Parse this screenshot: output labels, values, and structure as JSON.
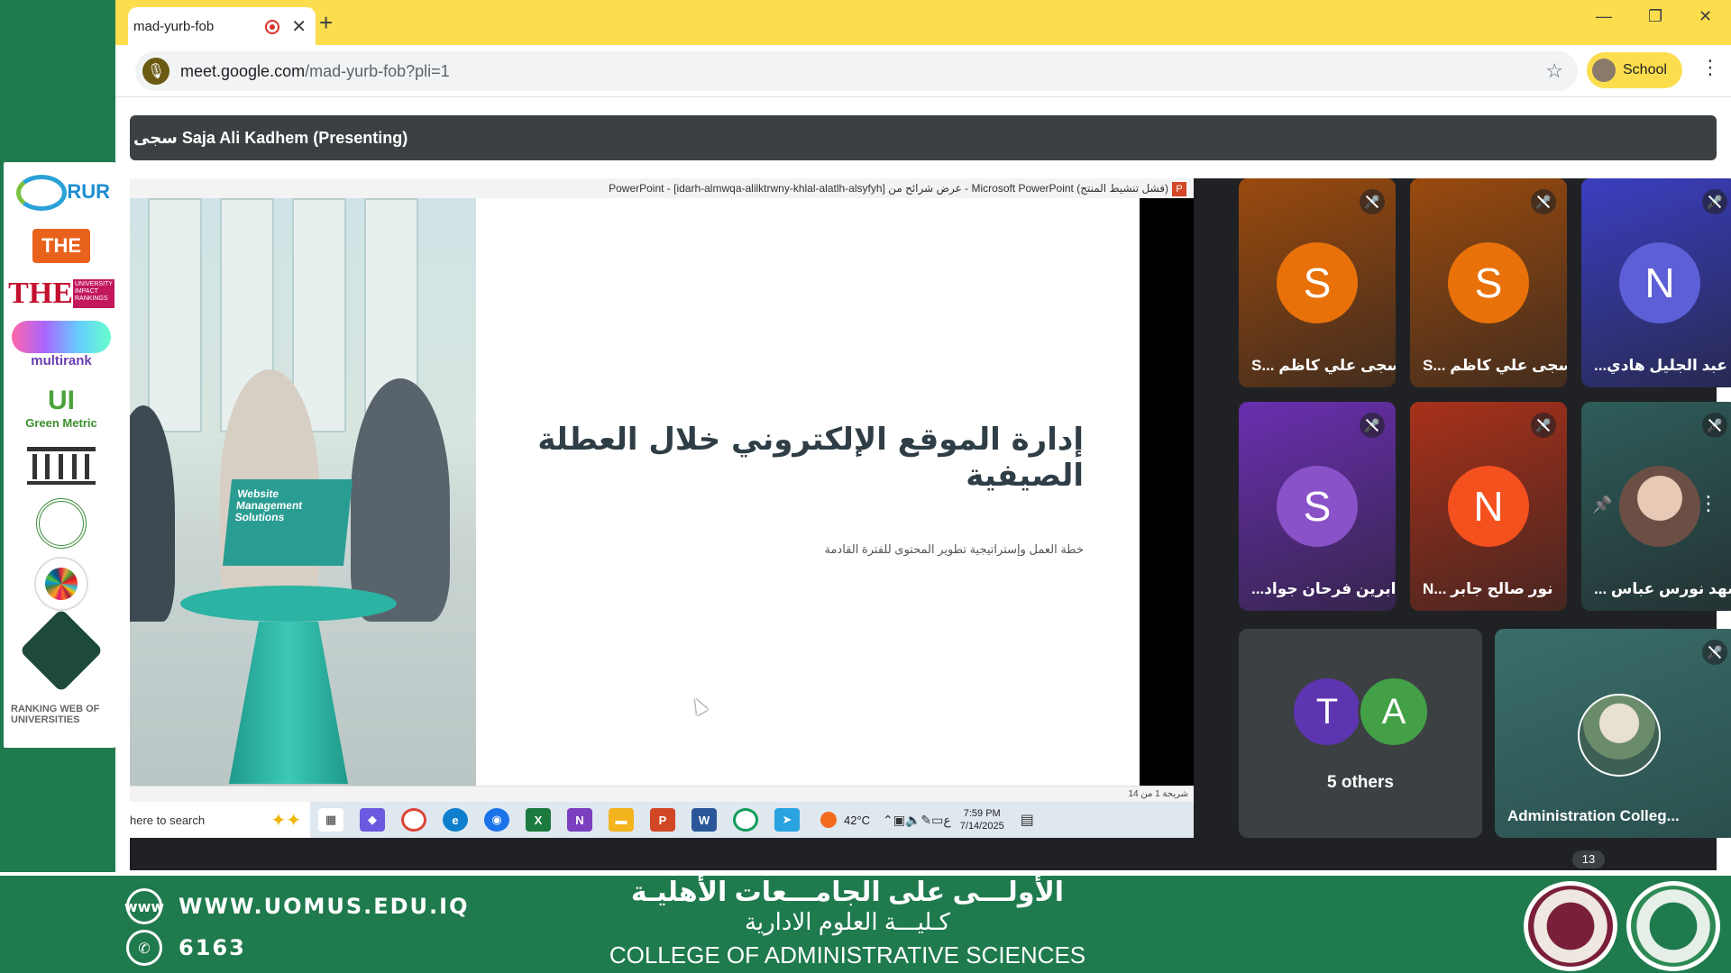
{
  "browser": {
    "tab_title": "mad-yurb-fob",
    "url_host": "meet.google.com",
    "url_path": "/mad-yurb-fob?pli=1",
    "profile_label": "School",
    "accent_color": "#fbdd4e"
  },
  "meet": {
    "presenter_label": "سجى Saja Ali Kadhem (Presenting)",
    "overflow_count": "13"
  },
  "shared_screen": {
    "window_title": "PowerPoint - [idarh-almwqa-alilktrwny-khlal-alatlh-alsyfyh] عرض شرائح من - Microsoft PowerPoint (فشل تنشيط المنتج)",
    "slide_heading": "إدارة الموقع الإلكتروني خلال العطلة الصيفية",
    "slide_subtitle": "خطة العمل وإستراتيجية تطوير المحتوى للفترة القادمة",
    "photo_screen_text": "Website Management Solutions",
    "status_text": "شريحة 1 من 14",
    "taskbar": {
      "search_placeholder": "here to search",
      "temperature": "42°C",
      "keyboard_lang": "ع",
      "time": "7:59 PM",
      "date": "7/14/2025"
    }
  },
  "participants": [
    {
      "initial": "S",
      "name": "S... سجى علي كاظم",
      "color": "#e8710a",
      "bg": "#9a4a0e",
      "muted": true
    },
    {
      "initial": "S",
      "name": "S... سجى علي كاظم",
      "color": "#e8710a",
      "bg": "#9a4a0e",
      "muted": true
    },
    {
      "initial": "N",
      "name": "...ر عبد الجليل هادي",
      "color": "#5c5fd6",
      "bg": "#3b3ec0",
      "muted": true
    },
    {
      "initial": "S",
      "name": "...ابرين فرحان جواد",
      "color": "#8a52c9",
      "bg": "#6a2fb0",
      "muted": true
    },
    {
      "initial": "N",
      "name": "N... نور صالح جابر",
      "color": "#f4511e",
      "bg": "#a8311a",
      "muted": true
    },
    {
      "initial": "",
      "name": "... شهد نورس عباس",
      "color": "",
      "bg": "#2e5d5a",
      "muted": true
    }
  ],
  "others_tile": {
    "avatars": [
      {
        "initial": "T",
        "color": "#5e35b1"
      },
      {
        "initial": "A",
        "color": "#43a047"
      }
    ],
    "label": "5 others"
  },
  "admin_tile": {
    "name": "Administration Colleg...",
    "muted": true
  },
  "side_logos": {
    "rur": "RUR",
    "the": "THE",
    "impact_bar": "UNIVERSITY IMPACT RANKINGS",
    "multirank": "multirank",
    "greenmetric_ui": "UI",
    "greenmetric": "Green Metric",
    "webometrics": "RANKING WEB OF UNIVERSITIES"
  },
  "banner": {
    "website": "WWW.UOMUS.EDU.IQ",
    "phone": "6163",
    "arabic_line1": "الأولـــى على الجامـــعات الأهليـة",
    "arabic_line2": "كـليـــة العلوم الادارية",
    "english_line": "COLLEGE OF ADMINISTRATIVE SCIENCES",
    "color": "#1f7a4d"
  }
}
